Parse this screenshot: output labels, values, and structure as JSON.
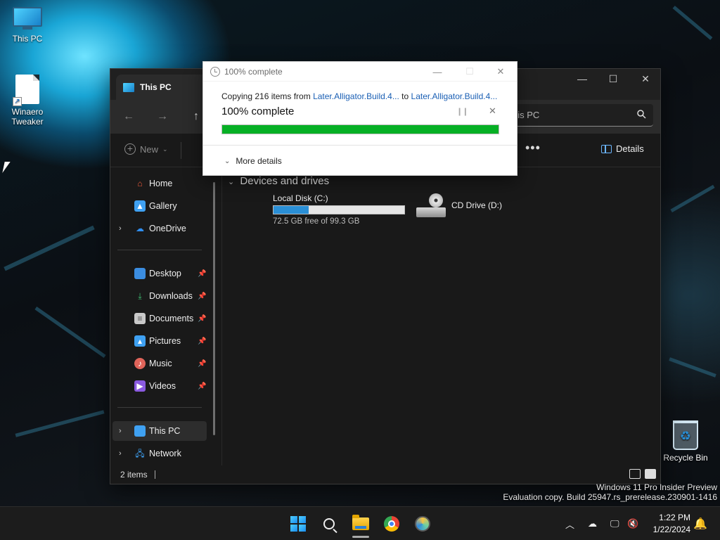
{
  "desktop": {
    "icons": [
      {
        "label": "This PC",
        "icon": "computer-icon"
      },
      {
        "label": "Winaero Tweaker",
        "icon": "shortcut-document-icon"
      },
      {
        "label": "Recycle Bin",
        "icon": "recycle-bin-icon"
      }
    ],
    "watermark": {
      "line1": "Windows 11 Pro Insider Preview",
      "line2": "Evaluation copy. Build 25947.rs_prerelease.230901-1416"
    }
  },
  "explorer": {
    "tab_title": "This PC",
    "search_placeholder": "his PC",
    "toolbar": {
      "new_label": "New",
      "more_label": "•••",
      "details_label": "Details"
    },
    "sidebar": {
      "items": [
        {
          "label": "Home",
          "icon": "home-icon",
          "color": "#f25c3c"
        },
        {
          "label": "Gallery",
          "icon": "gallery-icon",
          "color": "#3fa1f2"
        },
        {
          "label": "OneDrive",
          "icon": "onedrive-cloud-icon",
          "color": "#2f8ef0",
          "expandable": true
        },
        {
          "label": "Desktop",
          "icon": "desktop-icon",
          "color": "#3b8de0",
          "pinned": true
        },
        {
          "label": "Downloads",
          "icon": "downloads-icon",
          "color": "#3fbf73",
          "pinned": true
        },
        {
          "label": "Documents",
          "icon": "documents-icon",
          "color": "#c9c9c9",
          "pinned": true
        },
        {
          "label": "Pictures",
          "icon": "pictures-icon",
          "color": "#3fa1f2",
          "pinned": true
        },
        {
          "label": "Music",
          "icon": "music-icon",
          "color": "#e0645a",
          "pinned": true
        },
        {
          "label": "Videos",
          "icon": "videos-icon",
          "color": "#8a5ae0",
          "pinned": true
        },
        {
          "label": "This PC",
          "icon": "this-pc-icon",
          "color": "#3fa1f2",
          "expandable": true,
          "selected": true
        },
        {
          "label": "Network",
          "icon": "network-icon",
          "color": "#3fa1f2",
          "expandable": true
        }
      ]
    },
    "main": {
      "section_title": "Devices and drives",
      "drives": [
        {
          "name": "Local Disk (C:)",
          "free_text": "72.5 GB free of 99.3 GB",
          "used_fraction": 0.27
        },
        {
          "name": "CD Drive (D:)"
        }
      ]
    },
    "status": {
      "items_count": "2 items"
    }
  },
  "copy_dialog": {
    "title": "100% complete",
    "copying_prefix": "Copying 216 items from",
    "source": "Later.Alligator.Build.4...",
    "to_word": "to",
    "destination": "Later.Alligator.Build.4...",
    "percent_label": "100% complete",
    "progress_fraction": 1.0,
    "progress_color": "#06b025",
    "more_details_label": "More details"
  },
  "taskbar": {
    "apps": [
      "start-icon",
      "search-icon",
      "file-explorer-icon",
      "chrome-icon",
      "edge-canary-icon"
    ],
    "time": "1:22 PM",
    "date": "1/22/2024"
  }
}
